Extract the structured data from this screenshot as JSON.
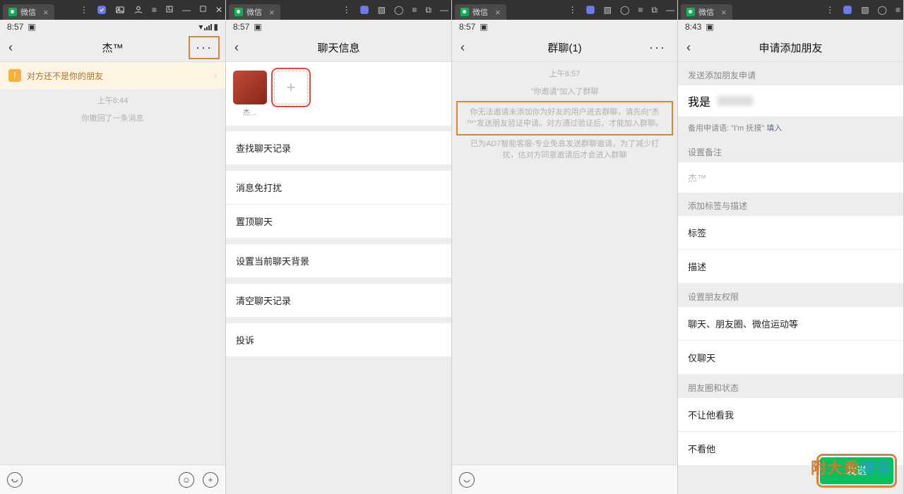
{
  "winbar": {
    "tab_label": "微信",
    "close": "×"
  },
  "status": {
    "time_a": "8:57",
    "time_d": "8:43"
  },
  "pane1": {
    "title": "杰™",
    "warn": "对方还不是你的朋友",
    "ts": "上午8:44",
    "msg": "你撤回了一条消息"
  },
  "pane2": {
    "title": "聊天信息",
    "avatar_label": "杰…",
    "items": [
      "查找聊天记录",
      "消息免打扰",
      "置顶聊天",
      "设置当前聊天背景",
      "清空聊天记录",
      "投诉"
    ]
  },
  "pane3": {
    "title": "群聊(1)",
    "ts": "上午8:57",
    "sys1": "\"你邀请\"加入了群聊",
    "sys2": "你无法邀请未添加你为好友的用户进去群聊，请先向\"杰™\"发送朋友验证申请。对方通过验证后，才能加入群聊。",
    "sys3": "已为AD7智能客服-专业免息发送群聊邀请，为了减少打扰，估对方同意邀请后才会进入群聊"
  },
  "pane4": {
    "title": "申请添加朋友",
    "sec1": "发送添加朋友申请",
    "username": "我是",
    "apply_note_pre": "备用申请语:",
    "apply_note_q": "\"I'm 抚摸\"",
    "apply_note_link": "填入",
    "sec2": "设置备注",
    "remark_ph": "杰™",
    "sec3": "添加标签与描述",
    "tag": "标签",
    "desc": "描述",
    "sec4": "设置朋友权限",
    "perm1": "聊天、朋友圈、微信运动等",
    "perm2": "仅聊天",
    "sec5": "朋友圈和状态",
    "priv1": "不让他看我",
    "priv2": "不看他",
    "send": "发送"
  },
  "watermark_a": "附大乘",
  "watermark_b": "博客"
}
